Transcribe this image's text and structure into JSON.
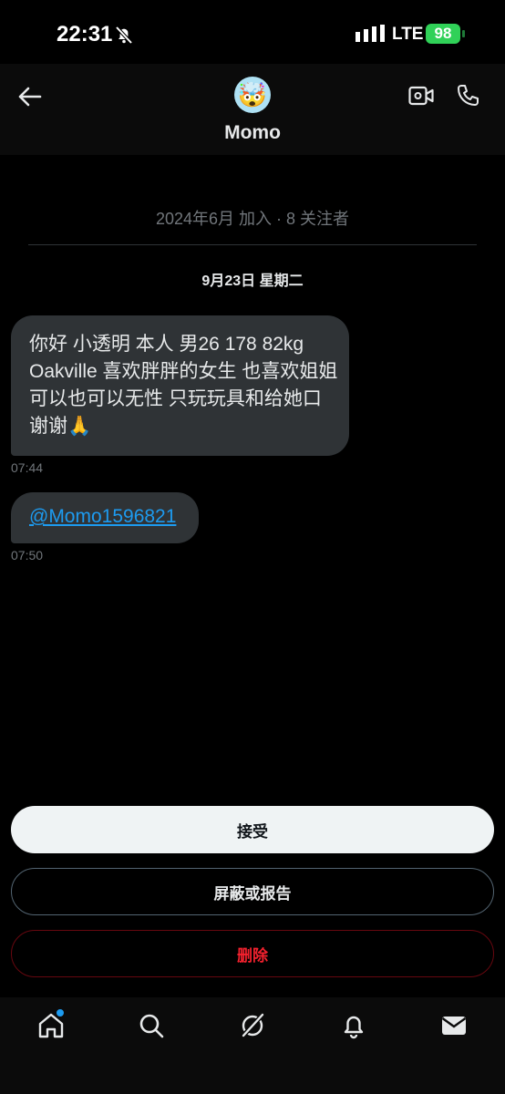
{
  "status_bar": {
    "time": "22:31",
    "network": "LTE",
    "battery": "98"
  },
  "header": {
    "name": "Momo",
    "avatar_emoji": "🤯",
    "back_icon": "arrow-left-icon",
    "video_icon": "video-call-icon",
    "phone_icon": "phone-icon"
  },
  "profile_info": {
    "joined": "2024年6月 加入 · 8 关注者"
  },
  "date_separator": "9月23日 星期二",
  "messages": [
    {
      "text": "你好 小透明 本人 男26 178 82kg Oakville 喜欢胖胖的女生 也喜欢姐姐 可以也可以无性 只玩玩具和给她口 谢谢🙏",
      "time": "07:44"
    },
    {
      "text": "@Momo1596821",
      "time": "07:50"
    }
  ],
  "actions": {
    "accept": "接受",
    "block_report": "屏蔽或报告",
    "delete": "删除"
  },
  "colors": {
    "accent": "#1d9bf0",
    "danger": "#f4212e",
    "bubble": "#2f3336",
    "battery": "#30d158"
  },
  "tabs": [
    "home-icon",
    "search-icon",
    "grok-icon",
    "notifications-icon",
    "messages-icon"
  ]
}
